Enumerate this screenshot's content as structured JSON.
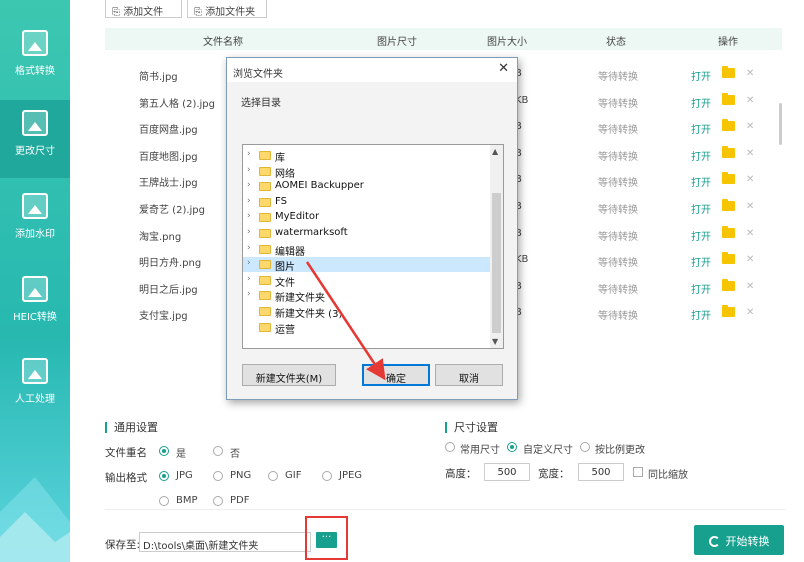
{
  "sidebar": {
    "items": [
      {
        "label": "格式转换"
      },
      {
        "label": "更改尺寸"
      },
      {
        "label": "添加水印"
      },
      {
        "label": "HEIC转换"
      },
      {
        "label": "人工处理"
      }
    ]
  },
  "toolbar": {
    "add_file": "添加文件",
    "add_folder": "添加文件夹"
  },
  "table": {
    "headers": {
      "name": "文件名称",
      "dims": "图片尺寸",
      "size": "图片大小",
      "status": "状态",
      "action": "操作"
    },
    "rows": [
      {
        "name": "简书.jpg",
        "size": "B",
        "status": "等待转换",
        "open": "打开"
      },
      {
        "name": "第五人格 (2).jpg",
        "size": "KB",
        "status": "等待转换",
        "open": "打开"
      },
      {
        "name": "百度网盘.jpg",
        "size": "B",
        "status": "等待转换",
        "open": "打开"
      },
      {
        "name": "百度地图.jpg",
        "size": "B",
        "status": "等待转换",
        "open": "打开"
      },
      {
        "name": "王牌战士.jpg",
        "size": "B",
        "status": "等待转换",
        "open": "打开"
      },
      {
        "name": "爱奇艺 (2).jpg",
        "size": "B",
        "status": "等待转换",
        "open": "打开"
      },
      {
        "name": "淘宝.png",
        "size": "B",
        "status": "等待转换",
        "open": "打开"
      },
      {
        "name": "明日方舟.png",
        "size": "KB",
        "status": "等待转换",
        "open": "打开"
      },
      {
        "name": "明日之后.jpg",
        "size": "B",
        "status": "等待转换",
        "open": "打开"
      },
      {
        "name": "支付宝.jpg",
        "size": "B",
        "status": "等待转换",
        "open": "打开"
      }
    ]
  },
  "general": {
    "title": "通用设置",
    "rename_label": "文件重名",
    "rename_yes": "是",
    "rename_no": "否",
    "format_label": "输出格式",
    "formats": [
      "JPG",
      "PNG",
      "GIF",
      "JPEG",
      "BMP",
      "PDF"
    ]
  },
  "size_settings": {
    "title": "尺寸设置",
    "options": [
      "常用尺寸",
      "自定义尺寸",
      "按比例更改"
    ],
    "height_label": "高度：",
    "height_value": "500",
    "width_label": "宽度：",
    "width_value": "500",
    "ratio_label": "同比缩放"
  },
  "save": {
    "label": "保存至:",
    "path": "D:\\tools\\桌面\\新建文件夹",
    "more": "···"
  },
  "start_label": "开始转换",
  "dialog": {
    "title": "浏览文件夹",
    "caption": "选择目录",
    "tree": [
      "库",
      "网络",
      "AOMEI Backupper",
      "FS",
      "MyEditor",
      "watermarksoft",
      "编辑器",
      "图片",
      "文件",
      "新建文件夹",
      "新建文件夹 (3)",
      "运营"
    ],
    "new_folder": "新建文件夹(M)",
    "ok": "确定",
    "cancel": "取消"
  },
  "colors": {
    "accent": "#17a08e",
    "highlight": "#e53935",
    "folder": "#f7c500"
  }
}
